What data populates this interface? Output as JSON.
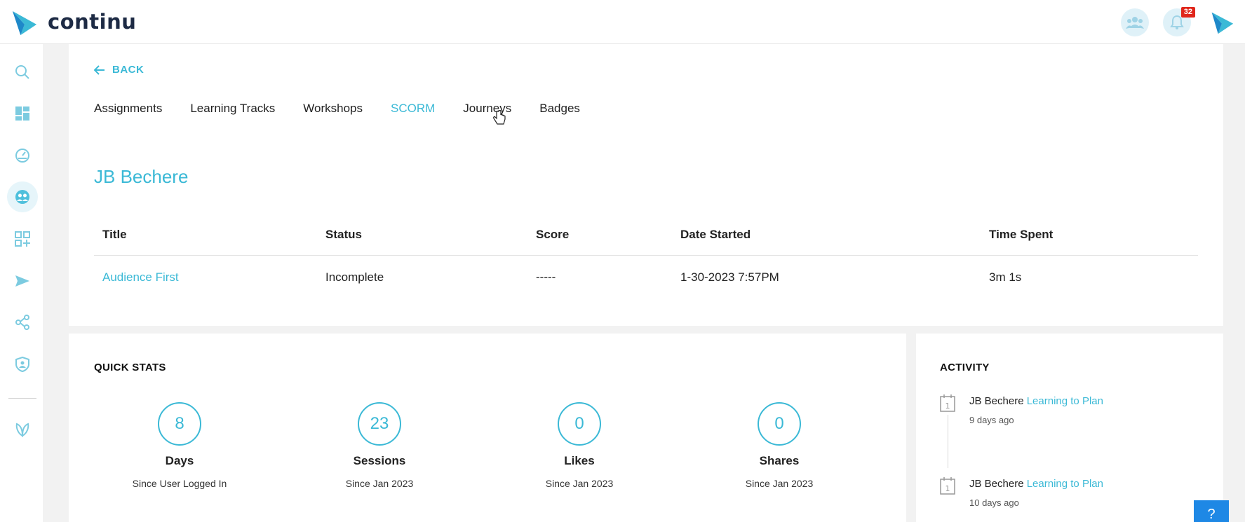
{
  "brand": {
    "name": "continu",
    "color": "#3bb9d6"
  },
  "topbar": {
    "team_icon": "team-icon",
    "notification_icon": "bell-icon",
    "notification_count": "32"
  },
  "sidebar": {
    "items": [
      {
        "icon": "search-icon"
      },
      {
        "icon": "dashboard-icon"
      },
      {
        "icon": "analytics-icon"
      },
      {
        "icon": "users-icon",
        "active": true
      },
      {
        "icon": "add-grid-icon"
      },
      {
        "icon": "send-icon"
      },
      {
        "icon": "share-icon"
      },
      {
        "icon": "shield-user-icon"
      },
      {
        "icon": "leaf-icon"
      }
    ]
  },
  "main": {
    "back_label": "BACK",
    "tabs": [
      {
        "label": "Assignments"
      },
      {
        "label": "Learning Tracks"
      },
      {
        "label": "Workshops"
      },
      {
        "label": "SCORM",
        "active": true
      },
      {
        "label": "Journeys"
      },
      {
        "label": "Badges"
      }
    ],
    "user_name": "JB Bechere",
    "table": {
      "headers": [
        "Title",
        "Status",
        "Score",
        "Date Started",
        "Time Spent"
      ],
      "rows": [
        [
          "Audience First",
          "Incomplete",
          "-----",
          "1-30-2023 7:57PM",
          "3m 1s"
        ]
      ]
    }
  },
  "quick_stats": {
    "title": "QUICK STATS",
    "items": [
      {
        "value": "8",
        "label": "Days",
        "sub": "Since User Logged In"
      },
      {
        "value": "23",
        "label": "Sessions",
        "sub": "Since Jan 2023"
      },
      {
        "value": "0",
        "label": "Likes",
        "sub": "Since Jan 2023"
      },
      {
        "value": "0",
        "label": "Shares",
        "sub": "Since Jan 2023"
      }
    ]
  },
  "activity": {
    "title": "ACTIVITY",
    "items": [
      {
        "user": "JB Bechere",
        "content": "Learning to Plan",
        "time": "9 days ago"
      },
      {
        "user": "JB Bechere",
        "content": "Learning to Plan",
        "time": "10 days ago"
      }
    ]
  },
  "help_label": "?"
}
